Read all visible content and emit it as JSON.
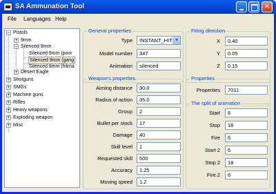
{
  "window": {
    "title": "SA Ammunation Tool"
  },
  "menu": [
    "File",
    "Languages",
    "Help"
  ],
  "tree": [
    {
      "label": "Pistols",
      "expander": "−"
    },
    {
      "label": "9mm",
      "expander": "+"
    },
    {
      "label": "Silenced 9mm",
      "expander": "−"
    },
    {
      "label": "Silenced 9mm (poor"
    },
    {
      "label": "Silenced 9mm (gang",
      "selected": true
    },
    {
      "label": "Silenced 9mm (hitma"
    },
    {
      "label": "Desert Eagle",
      "expander": "+"
    },
    {
      "label": "Shotguns",
      "expander": "+"
    },
    {
      "label": "SMGs",
      "expander": "+"
    },
    {
      "label": "Machine guns",
      "expander": "+"
    },
    {
      "label": "Rifles",
      "expander": "+"
    },
    {
      "label": "Heavy weapons",
      "expander": "+"
    },
    {
      "label": "Exploding weapon",
      "expander": "+"
    },
    {
      "label": "Misc",
      "expander": "+"
    }
  ],
  "general": {
    "title": "General properties",
    "fields": [
      {
        "label": "Type",
        "value": "INSTANT_HIT"
      },
      {
        "label": "Model number",
        "value": "347"
      },
      {
        "label": "Animation",
        "value": "silenced"
      }
    ]
  },
  "weapon": {
    "title": "Weapon's properties",
    "fields": [
      {
        "label": "Aiming distance",
        "value": "30.0"
      },
      {
        "label": "Radius of action",
        "value": "35.0"
      },
      {
        "label": "Group",
        "value": "2"
      },
      {
        "label": "Bullet per stock",
        "value": "17"
      },
      {
        "label": "Damage",
        "value": "40"
      },
      {
        "label": "Skill level",
        "value": "1"
      },
      {
        "label": "Requested skill",
        "value": "500"
      },
      {
        "label": "Accuracy",
        "value": "1.25"
      },
      {
        "label": "Moving speed",
        "value": "1.2"
      }
    ]
  },
  "firing": {
    "title": "Firing direction",
    "fields": [
      {
        "label": "X",
        "value": "0.40"
      },
      {
        "label": "Y",
        "value": "0.05"
      },
      {
        "label": "Z",
        "value": "0.15"
      }
    ]
  },
  "properties": {
    "title": "Properties",
    "fields": [
      {
        "label": "Properties",
        "value": "7011"
      }
    ]
  },
  "split": {
    "title": "The split of animation",
    "fields": [
      {
        "label": "Start",
        "value": "6"
      },
      {
        "label": "Stop",
        "value": "18"
      },
      {
        "label": "Fire",
        "value": "6"
      },
      {
        "label": "Start 2",
        "value": "6"
      },
      {
        "label": "Stop 2",
        "value": "18"
      },
      {
        "label": "Fire 2",
        "value": "6"
      }
    ]
  }
}
